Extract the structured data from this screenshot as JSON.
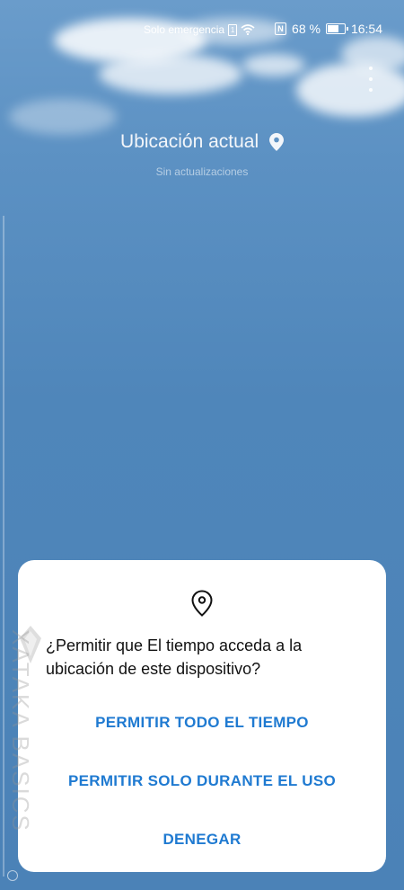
{
  "status_bar": {
    "carrier": "Solo emergencia",
    "battery_percent": "68 %",
    "time": "16:54"
  },
  "header": {
    "location_title": "Ubicación actual",
    "update_status": "Sin actualizaciones"
  },
  "dialog": {
    "question": "¿Permitir que El tiempo acceda a la ubicación de este dispositivo?",
    "buttons": {
      "allow_always": "PERMITIR TODO EL TIEMPO",
      "allow_while_using": "PERMITIR SOLO DURANTE EL USO",
      "deny": "DENEGAR"
    }
  },
  "watermark": {
    "text": "XATAKA BASICS"
  },
  "colors": {
    "accent": "#1f7ad1",
    "sky": "#4f86ba",
    "dialog_bg": "#ffffff"
  }
}
